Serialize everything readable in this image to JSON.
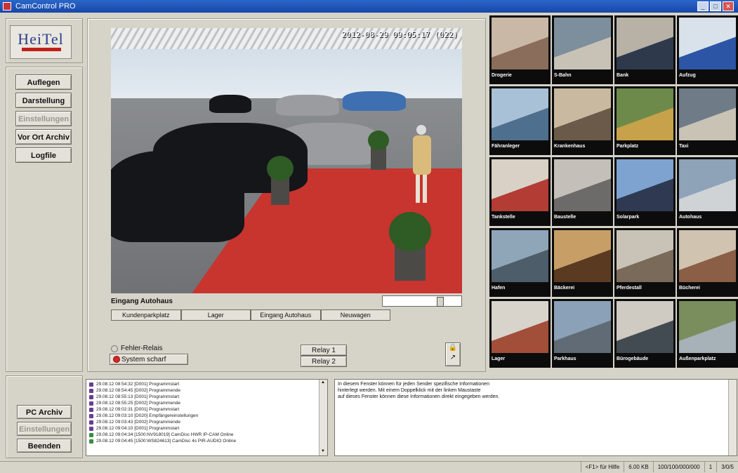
{
  "window": {
    "title": "CamControl PRO"
  },
  "logo": {
    "text": "HeiTel"
  },
  "sidebar": {
    "buttons": [
      {
        "label": "Auflegen",
        "enabled": true
      },
      {
        "label": "Darstellung",
        "enabled": true
      },
      {
        "label": "Einstellungen",
        "enabled": false
      },
      {
        "label": "Vor Ort Archiv",
        "enabled": true
      },
      {
        "label": "Logfile",
        "enabled": true
      }
    ],
    "bottom_buttons": [
      {
        "label": "PC Archiv",
        "enabled": true
      },
      {
        "label": "Einstellungen",
        "enabled": false
      },
      {
        "label": "Beenden",
        "enabled": true
      }
    ]
  },
  "camera": {
    "timestamp": "2012-08-29 09:05:17 (022)",
    "label": "Eingang Autohaus",
    "slider_level": 0.75,
    "tabs": [
      "Kundenparkplatz",
      "Lager",
      "Eingang Autohaus",
      "Neuwagen"
    ]
  },
  "relays": {
    "fehler": "Fehler-Relais",
    "system": "System scharf",
    "relay1": "Relay 1",
    "relay2": "Relay 2"
  },
  "thumbnails": [
    "Drogerie",
    "S-Bahn",
    "Bank",
    "Aufzug",
    "Fähranleger",
    "Krankenhaus",
    "Parkplatz",
    "Taxi",
    "Tankstelle",
    "Baustelle",
    "Solarpark",
    "Autohaus",
    "Hafen",
    "Bäckerei",
    "Pferdestall",
    "Bücherei",
    "Lager",
    "Parkhaus",
    "Bürogebäude",
    "Außenparkplatz"
  ],
  "log": [
    "29.08.12 08:54:32 [D001] Programmstart",
    "29.08.12 08:54:45 [D002] Programmende",
    "29.08.12 08:55:13 [D001] Programmstart",
    "29.08.12 08:55:25 [D002] Programmende",
    "29.08.12 09:02:31 [D001] Programmstart",
    "29.08.12 09:03:10 [D020] Empfängereinstellungen",
    "29.08.12 09:03:43 [D002] Programmende",
    "29.08.12 09:04:10 [D001] Programmstart",
    "29.08.12 09:04:34 [1500:NV918019] CamDisc HWR IP-CAM Online",
    "29.08.12 09:04:45 [1500:WS824613] CamDisc 4s PIR-AUDIO Online"
  ],
  "info": {
    "line1": "In diesem Fenster können für jeden Sender spezifische Informationen",
    "line2": "hinterlegt werden. Mit einem Doppelklick mit der linken Maustaste",
    "line3": "auf dieses Fenster können diese Informationen direkt eingegeben werden."
  },
  "statusbar": {
    "help": "<F1> für Hilfe",
    "size": "6.00 KB",
    "counters": "100/100/000/000",
    "num": "1",
    "page": "3/0/5"
  }
}
